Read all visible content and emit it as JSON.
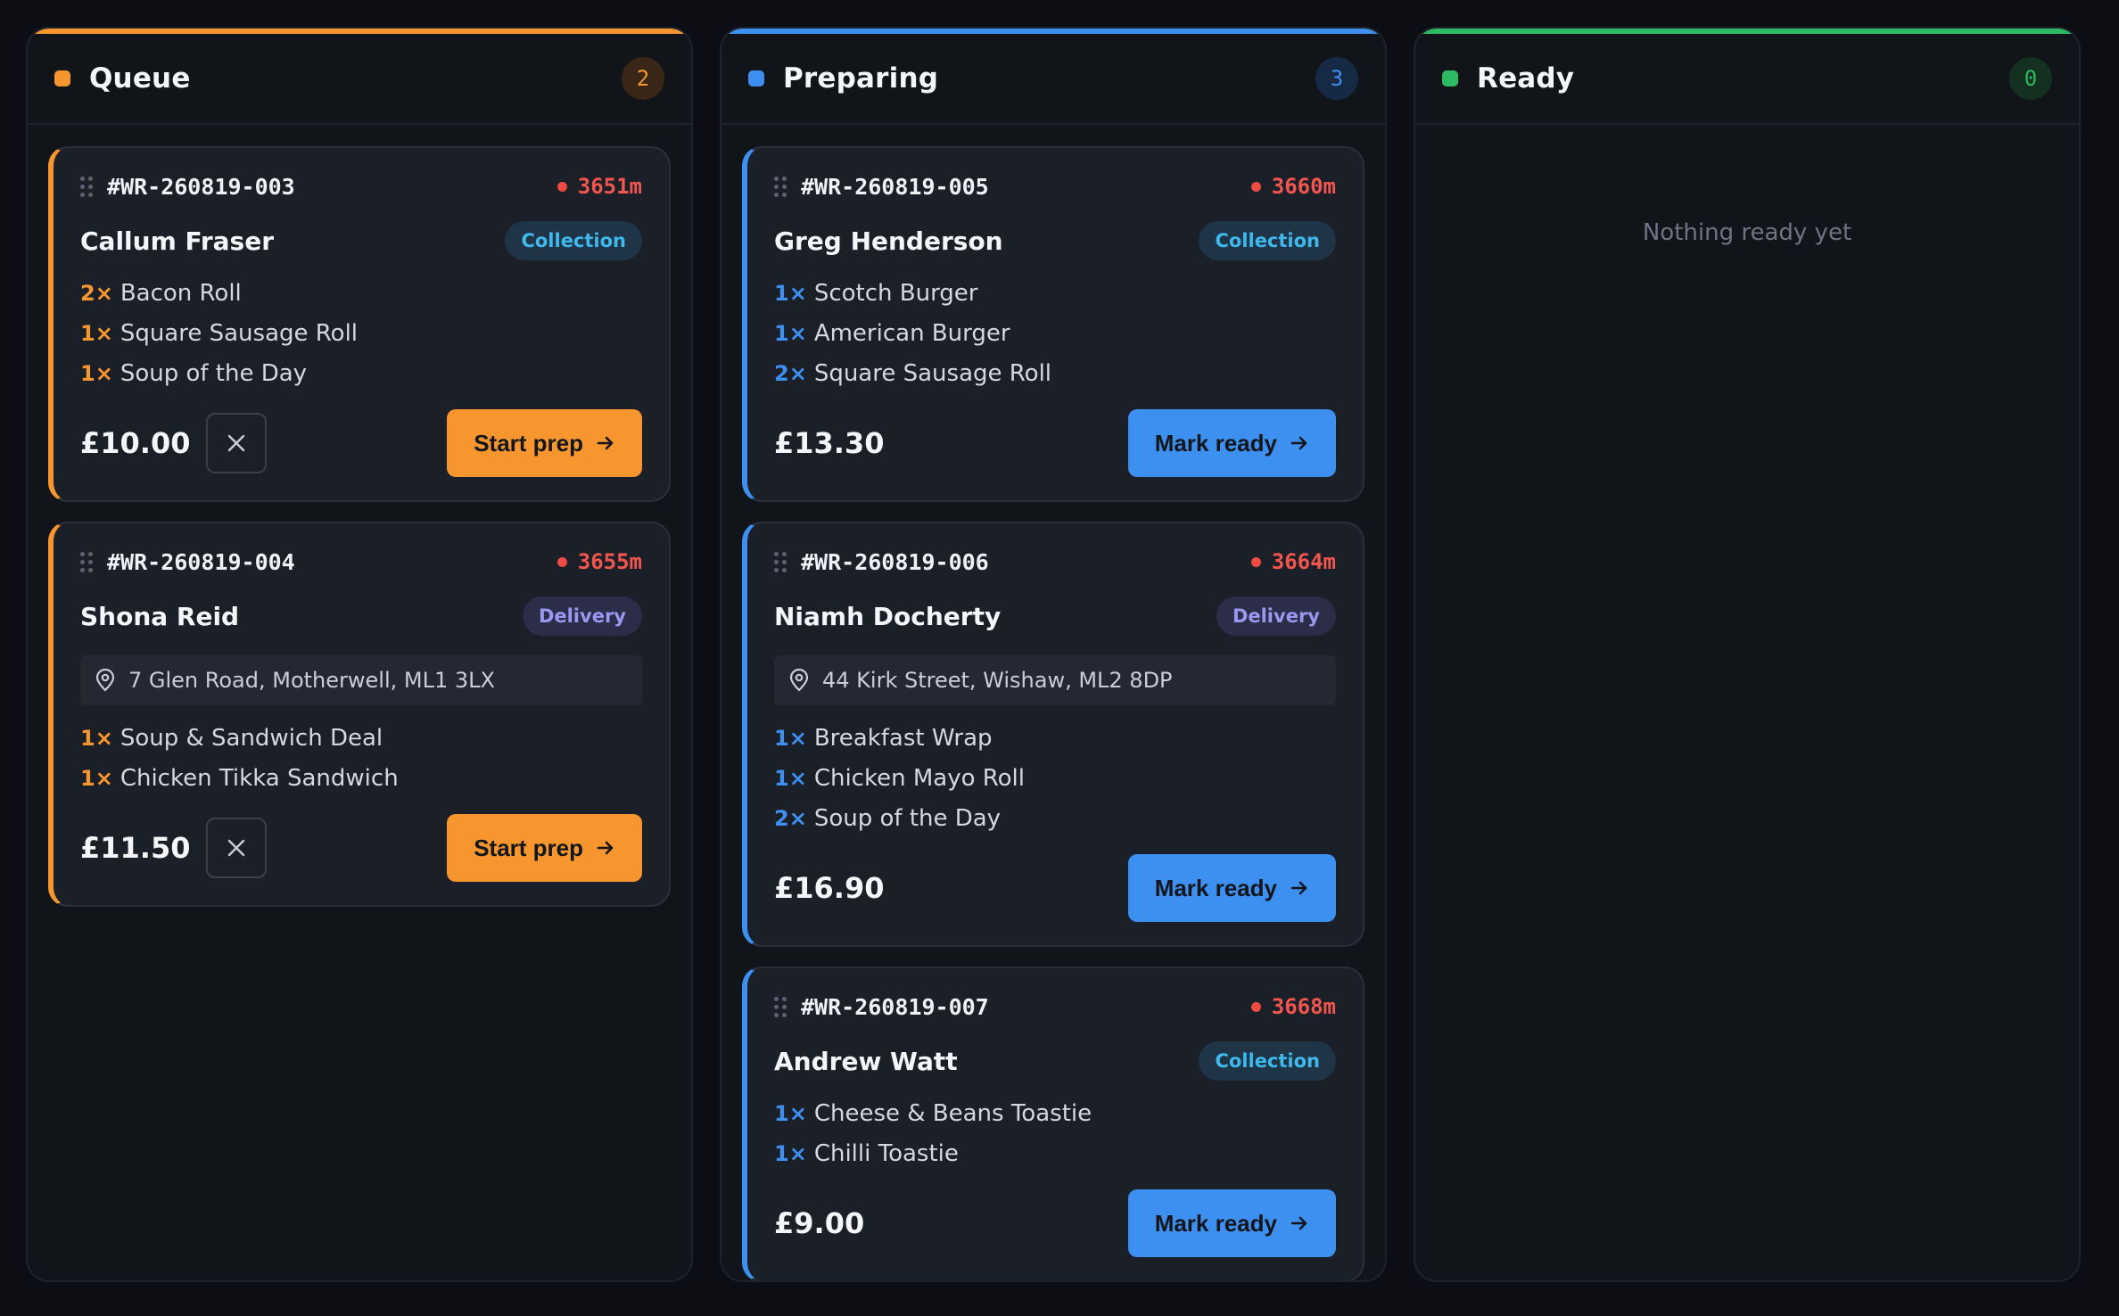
{
  "columns": [
    {
      "title": "Queue",
      "count": "2",
      "accent": "#f7962f",
      "action_label": "Start prep",
      "cards": [
        {
          "order_id": "#WR-260819-003",
          "timer": "3651m",
          "customer": "Callum Fraser",
          "type": "Collection",
          "items": [
            {
              "qty": "2×",
              "name": "Bacon Roll"
            },
            {
              "qty": "1×",
              "name": "Square Sausage Roll"
            },
            {
              "qty": "1×",
              "name": "Soup of the Day"
            }
          ],
          "price": "£10.00"
        },
        {
          "order_id": "#WR-260819-004",
          "timer": "3655m",
          "customer": "Shona Reid",
          "type": "Delivery",
          "address": "7 Glen Road, Motherwell, ML1 3LX",
          "items": [
            {
              "qty": "1×",
              "name": "Soup & Sandwich Deal"
            },
            {
              "qty": "1×",
              "name": "Chicken Tikka Sandwich"
            }
          ],
          "price": "£11.50"
        }
      ]
    },
    {
      "title": "Preparing",
      "count": "3",
      "accent": "#3d8ff0",
      "action_label": "Mark ready",
      "cards": [
        {
          "order_id": "#WR-260819-005",
          "timer": "3660m",
          "customer": "Greg Henderson",
          "type": "Collection",
          "items": [
            {
              "qty": "1×",
              "name": "Scotch Burger"
            },
            {
              "qty": "1×",
              "name": "American Burger"
            },
            {
              "qty": "2×",
              "name": "Square Sausage Roll"
            }
          ],
          "price": "£13.30"
        },
        {
          "order_id": "#WR-260819-006",
          "timer": "3664m",
          "customer": "Niamh Docherty",
          "type": "Delivery",
          "address": "44 Kirk Street, Wishaw, ML2 8DP",
          "items": [
            {
              "qty": "1×",
              "name": "Breakfast Wrap"
            },
            {
              "qty": "1×",
              "name": "Chicken Mayo Roll"
            },
            {
              "qty": "2×",
              "name": "Soup of the Day"
            }
          ],
          "price": "£16.90"
        },
        {
          "order_id": "#WR-260819-007",
          "timer": "3668m",
          "customer": "Andrew Watt",
          "type": "Collection",
          "items": [
            {
              "qty": "1×",
              "name": "Cheese & Beans Toastie"
            },
            {
              "qty": "1×",
              "name": "Chilli Toastie"
            }
          ],
          "price": "£9.00"
        }
      ]
    },
    {
      "title": "Ready",
      "count": "0",
      "accent": "#2cba62",
      "empty_text": "Nothing ready yet",
      "cards": []
    }
  ]
}
